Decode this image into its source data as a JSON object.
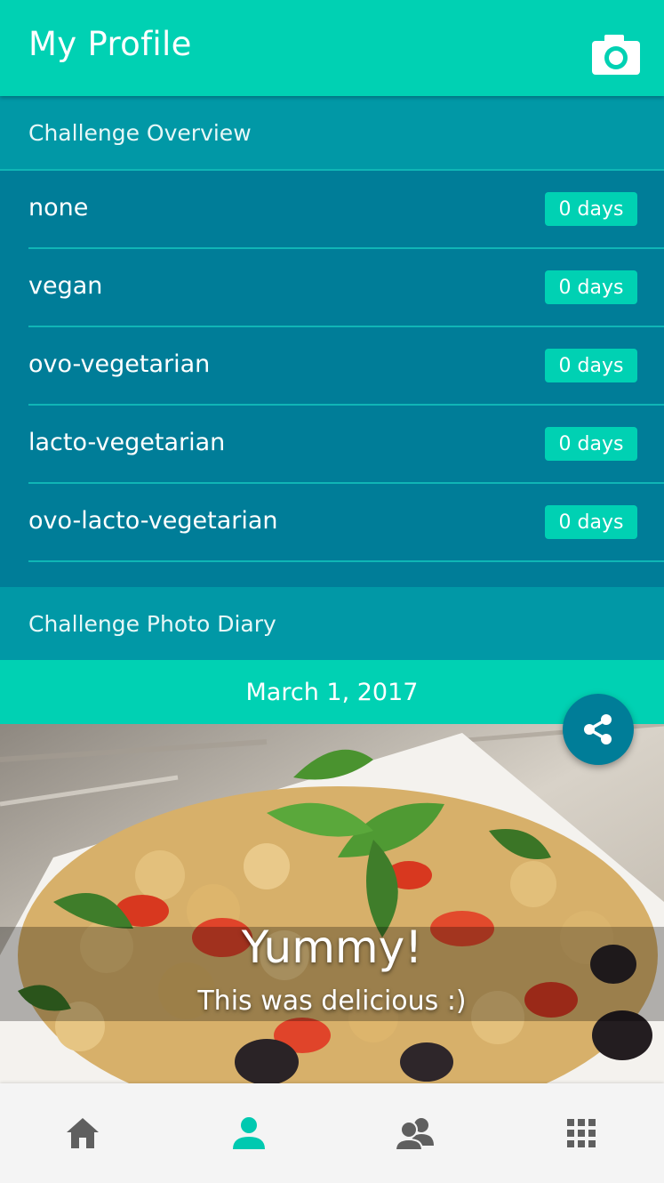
{
  "header": {
    "title": "My Profile",
    "camera_icon": "camera-icon"
  },
  "overview": {
    "section_title": "Challenge Overview",
    "items": [
      {
        "label": "none",
        "badge": "0 days"
      },
      {
        "label": "vegan",
        "badge": "0 days"
      },
      {
        "label": "ovo-vegetarian",
        "badge": "0 days"
      },
      {
        "label": "lacto-vegetarian",
        "badge": "0 days"
      },
      {
        "label": "ovo-lacto-vegetarian",
        "badge": "0 days"
      }
    ]
  },
  "diary": {
    "section_title": "Challenge Photo Diary",
    "entry": {
      "date": "March 1, 2017",
      "title": "Yummy!",
      "caption": "This was delicious :)",
      "share_icon": "share-icon"
    }
  },
  "bottom_nav": {
    "items": [
      {
        "icon": "home-icon",
        "active": false
      },
      {
        "icon": "person-icon",
        "active": true
      },
      {
        "icon": "group-icon",
        "active": false
      },
      {
        "icon": "grid-icon",
        "active": false
      }
    ]
  },
  "colors": {
    "primary": "#00d1b3",
    "dark": "#007d98",
    "section": "#0198a6",
    "nav_active": "#00c9b0",
    "nav_inactive": "#5f5f5f"
  }
}
